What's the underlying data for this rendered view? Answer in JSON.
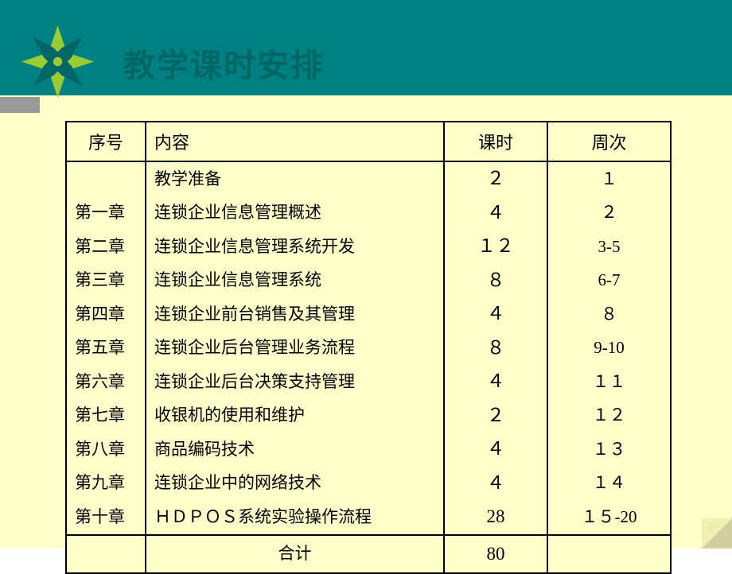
{
  "title": "教学课时安排",
  "headers": {
    "col1": "序号",
    "col2": "内容",
    "col3": "课时",
    "col4": "周次"
  },
  "rows": [
    {
      "seq": "",
      "content": "教学准备",
      "hours": "２",
      "week": "１"
    },
    {
      "seq": "第一章",
      "content": "连锁企业信息管理概述",
      "hours": "４",
      "week": "２"
    },
    {
      "seq": "第二章",
      "content": "连锁企业信息管理系统开发",
      "hours": "１２",
      "week": "3-5"
    },
    {
      "seq": "第三章",
      "content": "连锁企业信息管理系统",
      "hours": "８",
      "week": "6-7"
    },
    {
      "seq": "第四章",
      "content": "连锁企业前台销售及其管理",
      "hours": "４",
      "week": "８"
    },
    {
      "seq": "第五章",
      "content": "连锁企业后台管理业务流程",
      "hours": "８",
      "week": "9-10"
    },
    {
      "seq": "第六章",
      "content": "连锁企业后台决策支持管理",
      "hours": "４",
      "week": "１１"
    },
    {
      "seq": "第七章",
      "content": "收银机的使用和维护",
      "hours": "２",
      "week": "１２"
    },
    {
      "seq": "第八章",
      "content": "商品编码技术",
      "hours": "４",
      "week": "１３"
    },
    {
      "seq": "第九章",
      "content": "连锁企业中的网络技术",
      "hours": "４",
      "week": "１４"
    },
    {
      "seq": "第十章",
      "content": "ＨＤＰＯＳ系统实验操作流程",
      "hours": "28",
      "week": "１５-20"
    }
  ],
  "footer": {
    "label": "合计",
    "total": "80"
  },
  "chart_data": {
    "type": "table",
    "title": "教学课时安排",
    "columns": [
      "序号",
      "内容",
      "课时",
      "周次"
    ],
    "rows": [
      [
        "",
        "教学准备",
        2,
        "1"
      ],
      [
        "第一章",
        "连锁企业信息管理概述",
        4,
        "2"
      ],
      [
        "第二章",
        "连锁企业信息管理系统开发",
        12,
        "3-5"
      ],
      [
        "第三章",
        "连锁企业信息管理系统",
        8,
        "6-7"
      ],
      [
        "第四章",
        "连锁企业前台销售及其管理",
        4,
        "8"
      ],
      [
        "第五章",
        "连锁企业后台管理业务流程",
        8,
        "9-10"
      ],
      [
        "第六章",
        "连锁企业后台决策支持管理",
        4,
        "11"
      ],
      [
        "第七章",
        "收银机的使用和维护",
        2,
        "12"
      ],
      [
        "第八章",
        "商品编码技术",
        4,
        "13"
      ],
      [
        "第九章",
        "连锁企业中的网络技术",
        4,
        "14"
      ],
      [
        "第十章",
        "ＨＤＰＯＳ系统实验操作流程",
        28,
        "15-20"
      ]
    ],
    "total_hours": 80
  }
}
